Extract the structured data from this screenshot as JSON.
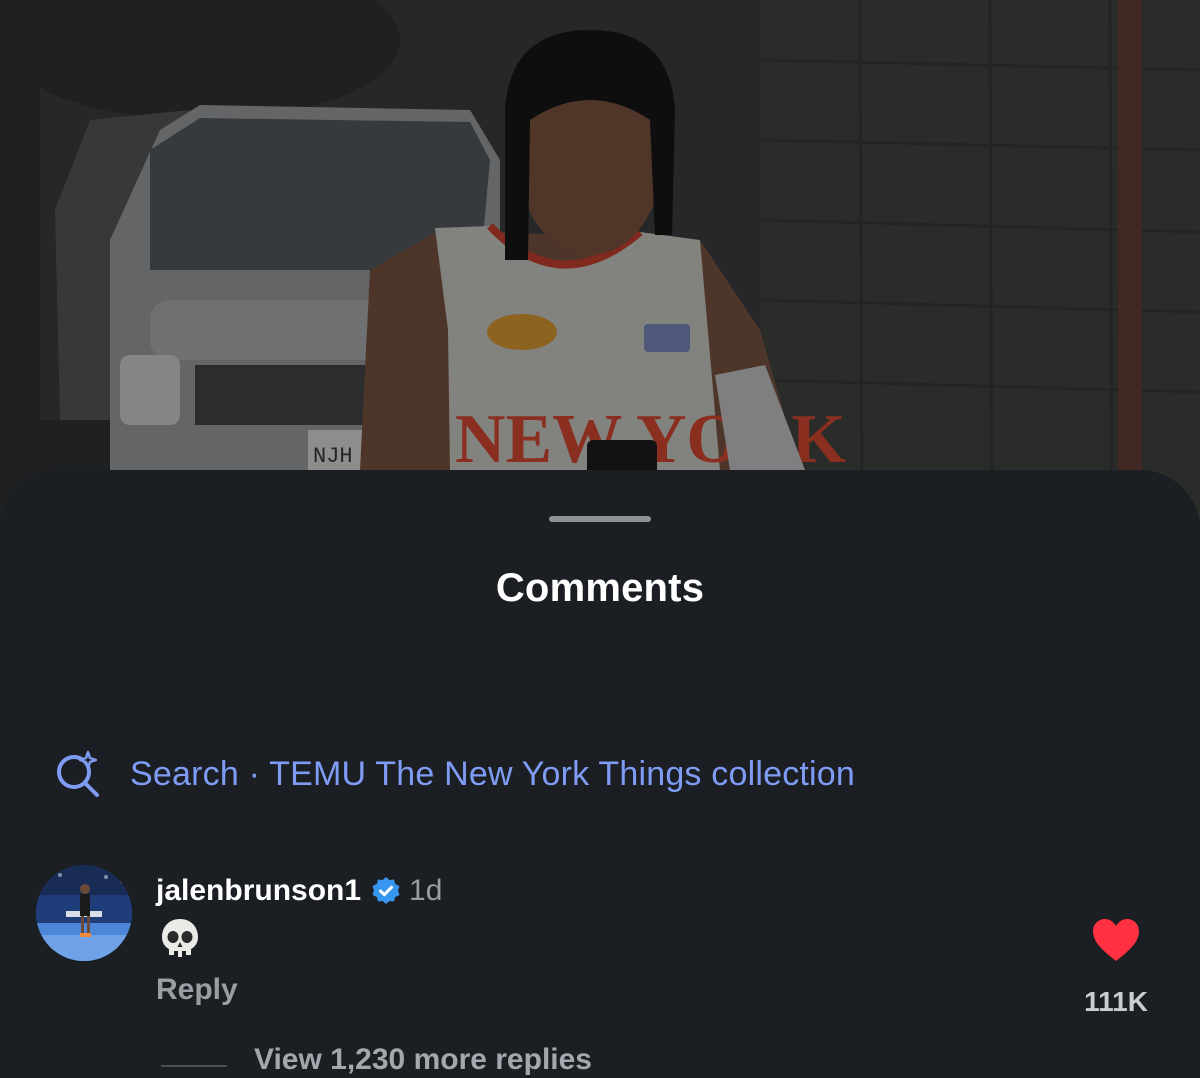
{
  "video": {
    "background_colors": {
      "wall": "#3d3f3d",
      "car": "#8a8c8e",
      "jersey": "#b8b8b4",
      "jersey_accent": "#c7442e",
      "skin": "#6e4b3a",
      "hair": "#161616"
    },
    "jersey_text": "NEW YORK",
    "plate_text": "NJH"
  },
  "sheet": {
    "title": "Comments",
    "search_suggestion": {
      "icon": "sparkle-search-icon",
      "text": "Search · TEMU The New York Things collection",
      "color": "#7f9cf5"
    }
  },
  "comments": [
    {
      "username": "jalenbrunson1",
      "verified": true,
      "verified_color": "#3797f0",
      "time": "1d",
      "text": "💀",
      "reply_label": "Reply",
      "likes": "111K",
      "liked": true,
      "like_color": "#ff3040",
      "view_replies_label": "View 1,230 more replies"
    }
  ]
}
